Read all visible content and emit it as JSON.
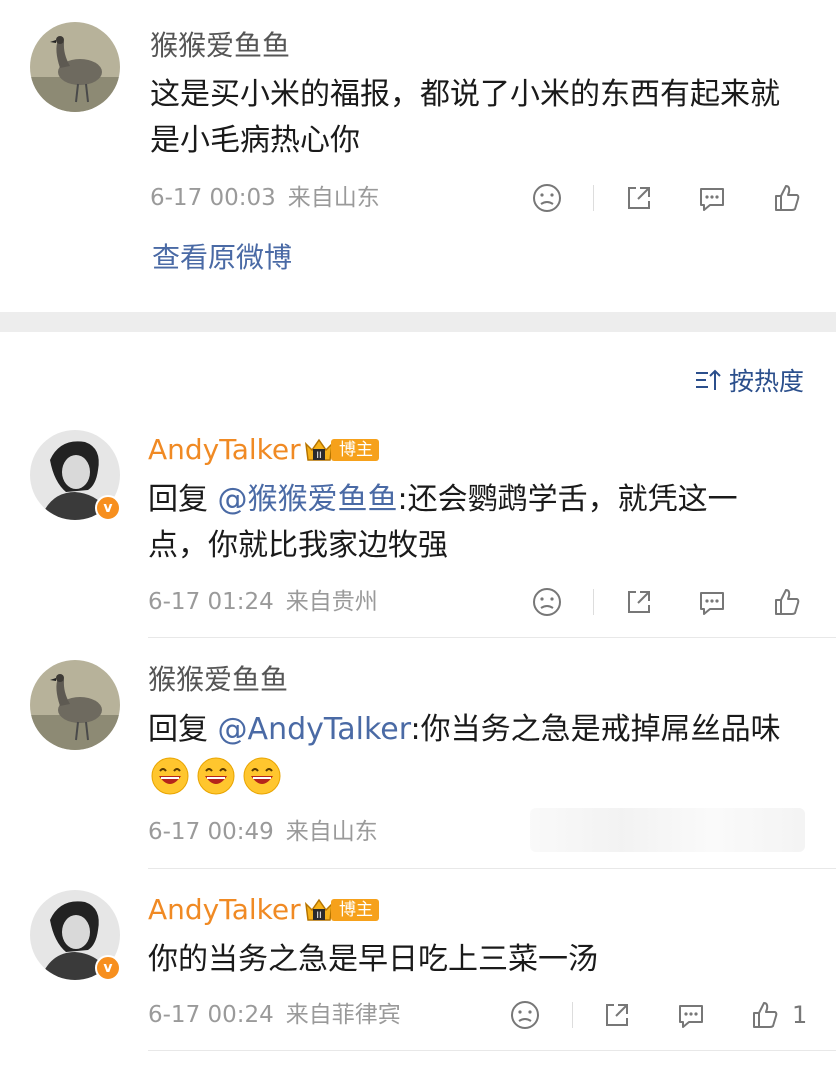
{
  "post": {
    "author": "猴猴爱鱼鱼",
    "text": "这是买小米的福报，都说了小米的东西有起来就是小毛病热心你",
    "time": "6-17 00:03",
    "location": "来自山东",
    "view_original": "查看原微博"
  },
  "sort": {
    "label": "按热度",
    "icon": "sort-icon"
  },
  "comments": [
    {
      "author": "AndyTalker",
      "badge": "博主",
      "reply_prefix": "回复 ",
      "mention": "@猴猴爱鱼鱼",
      "text": ":还会鹦鹉学舌，就凭这一点，你就比我家边牧强",
      "time": "6-17 01:24",
      "location": "来自贵州"
    },
    {
      "author": "猴猴爱鱼鱼",
      "reply_prefix": "回复 ",
      "mention": "@AndyTalker",
      "text": ":你当务之急是戒掉屌丝品味",
      "emoji_count": 3,
      "time": "6-17 00:49",
      "location": "来自山东"
    },
    {
      "author": "AndyTalker",
      "badge": "博主",
      "text": "你的当务之急是早日吃上三菜一汤",
      "time": "6-17 00:24",
      "location": "来自菲律宾",
      "like_count": "1"
    }
  ],
  "colors": {
    "accent_orange": "#f08a24",
    "link_blue": "#4a6aa5",
    "badge_orange": "#f6a11b"
  }
}
